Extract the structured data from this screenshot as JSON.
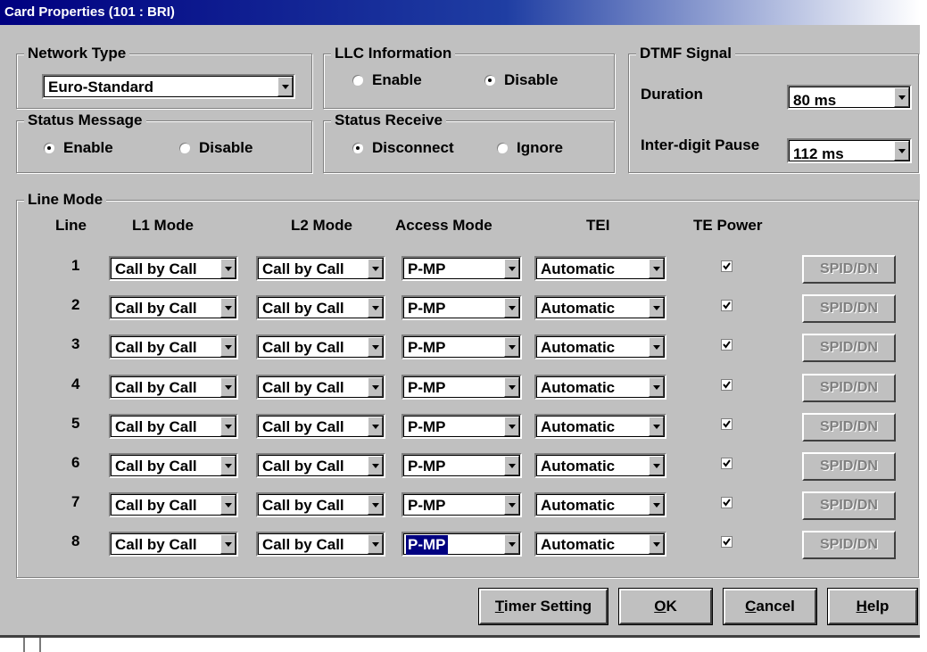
{
  "window": {
    "title": "Card Properties (101 : BRI)"
  },
  "network_type": {
    "label": "Network Type",
    "value": "Euro-Standard"
  },
  "llc_information": {
    "label": "LLC Information",
    "enable": "Enable",
    "disable": "Disable",
    "selected": "Disable"
  },
  "dtmf_signal": {
    "label": "DTMF Signal",
    "duration_label": "Duration",
    "duration_value": "80 ms",
    "pause_label": "Inter-digit Pause",
    "pause_value": "112 ms"
  },
  "status_message": {
    "label": "Status Message",
    "enable": "Enable",
    "disable": "Disable",
    "selected": "Enable"
  },
  "status_receive": {
    "label": "Status Receive",
    "disconnect": "Disconnect",
    "ignore": "Ignore",
    "selected": "Disconnect"
  },
  "line_mode": {
    "label": "Line Mode",
    "headers": {
      "line": "Line",
      "l1": "L1 Mode",
      "l2": "L2 Mode",
      "access": "Access Mode",
      "tei": "TEI",
      "power": "TE Power"
    },
    "spid_label": "SPID/DN",
    "rows": [
      {
        "line": "1",
        "l1": "Call by Call",
        "l2": "Call by Call",
        "access": "P-MP",
        "tei": "Automatic",
        "te_power": true
      },
      {
        "line": "2",
        "l1": "Call by Call",
        "l2": "Call by Call",
        "access": "P-MP",
        "tei": "Automatic",
        "te_power": true
      },
      {
        "line": "3",
        "l1": "Call by Call",
        "l2": "Call by Call",
        "access": "P-MP",
        "tei": "Automatic",
        "te_power": true
      },
      {
        "line": "4",
        "l1": "Call by Call",
        "l2": "Call by Call",
        "access": "P-MP",
        "tei": "Automatic",
        "te_power": true
      },
      {
        "line": "5",
        "l1": "Call by Call",
        "l2": "Call by Call",
        "access": "P-MP",
        "tei": "Automatic",
        "te_power": true
      },
      {
        "line": "6",
        "l1": "Call by Call",
        "l2": "Call by Call",
        "access": "P-MP",
        "tei": "Automatic",
        "te_power": true
      },
      {
        "line": "7",
        "l1": "Call by Call",
        "l2": "Call by Call",
        "access": "P-MP",
        "tei": "Automatic",
        "te_power": true
      },
      {
        "line": "8",
        "l1": "Call by Call",
        "l2": "Call by Call",
        "access": "P-MP",
        "tei": "Automatic",
        "te_power": true,
        "access_focused": true
      }
    ]
  },
  "buttons": {
    "timer_mn": "T",
    "timer_rest": "imer Setting",
    "ok_mn": "O",
    "ok_rest": "K",
    "cancel_mn": "C",
    "cancel_rest": "ancel",
    "help_mn": "H",
    "help_rest": "elp"
  }
}
